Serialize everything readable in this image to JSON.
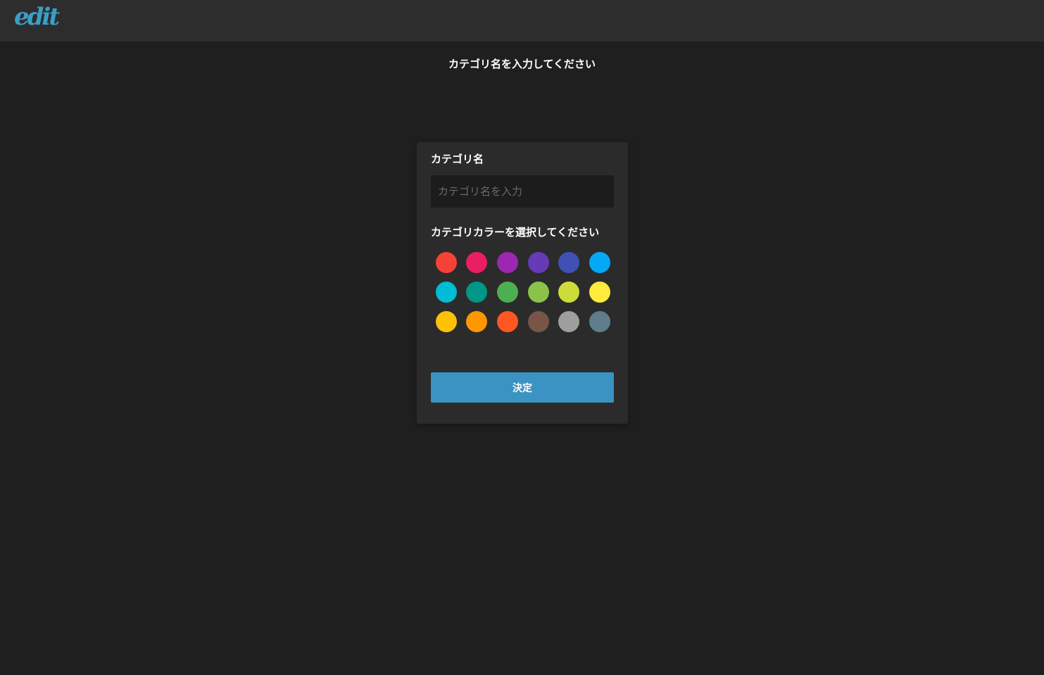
{
  "header": {
    "logo_text": "edit",
    "logo_color": "#3a9fc8"
  },
  "page": {
    "title": "カテゴリ名を入力してください"
  },
  "form": {
    "name_label": "カテゴリ名",
    "name_placeholder": "カテゴリ名を入力",
    "name_value": "",
    "color_label": "カテゴリカラーを選択してください",
    "submit_label": "決定",
    "submit_color": "#3a93c3",
    "colors": [
      "#f44336",
      "#e91e63",
      "#9c27b0",
      "#673ab7",
      "#3f51b5",
      "#03a9f4",
      "#00bcd4",
      "#009688",
      "#4caf50",
      "#8bc34a",
      "#cddc39",
      "#ffeb3b",
      "#ffc107",
      "#ff9800",
      "#ff5722",
      "#795548",
      "#9e9e9e",
      "#607d8b"
    ]
  }
}
